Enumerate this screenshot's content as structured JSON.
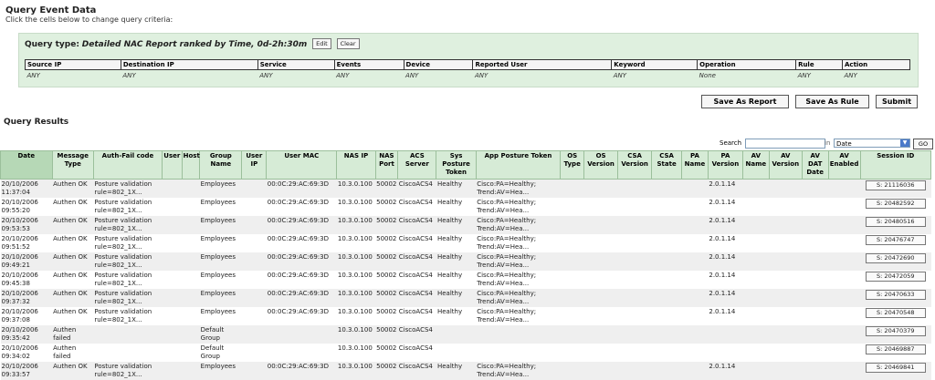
{
  "header": {
    "title": "Query Event Data",
    "subtitle": "Click the cells below to change query criteria:"
  },
  "query": {
    "label": "Query type:",
    "value": "Detailed NAC Report ranked by Time, 0d-2h:30m",
    "edit": "Edit",
    "clear": "Clear"
  },
  "criteria": {
    "headers": [
      "Source IP",
      "Destination IP",
      "Service",
      "Events",
      "Device",
      "Reported User",
      "Keyword",
      "Operation",
      "Rule",
      "Action"
    ],
    "values": [
      "ANY",
      "ANY",
      "ANY",
      "ANY",
      "ANY",
      "ANY",
      "ANY",
      "None",
      "ANY",
      "ANY"
    ]
  },
  "actions": {
    "save_report": "Save As Report",
    "save_rule": "Save As Rule",
    "submit": "Submit"
  },
  "results_title": "Query Results",
  "search": {
    "label": "Search",
    "in_label": "in",
    "field": "Date",
    "go": "GO"
  },
  "columns": [
    "Date",
    "Message Type",
    "Auth-Fail code",
    "User",
    "Host",
    "Group Name",
    "User IP",
    "User MAC",
    "NAS IP",
    "NAS Port",
    "ACS Server",
    "Sys Posture Token",
    "App Posture Token",
    "OS Type",
    "OS Version",
    "CSA Version",
    "CSA State",
    "PA Name",
    "PA Version",
    "AV Name",
    "AV Version",
    "AV DAT Date",
    "AV Enabled",
    "Session ID"
  ],
  "rows": [
    [
      "20/10/2006 11:37:04",
      "Authen OK",
      "Posture validation rule=802_1X...",
      "",
      "",
      "Employees",
      "",
      "00:0C:29:AC:69:3D",
      "10.3.0.100",
      "50002",
      "CiscoACS4",
      "Healthy",
      "Cisco:PA=Healthy; Trend:AV=Hea...",
      "",
      "",
      "",
      "",
      "",
      "2.0.1.14",
      "",
      "",
      "",
      "",
      "S: 21116036"
    ],
    [
      "20/10/2006 09:55:20",
      "Authen OK",
      "Posture validation rule=802_1X...",
      "",
      "",
      "Employees",
      "",
      "00:0C:29:AC:69:3D",
      "10.3.0.100",
      "50002",
      "CiscoACS4",
      "Healthy",
      "Cisco:PA=Healthy; Trend:AV=Hea...",
      "",
      "",
      "",
      "",
      "",
      "2.0.1.14",
      "",
      "",
      "",
      "",
      "S: 20482592"
    ],
    [
      "20/10/2006 09:53:53",
      "Authen OK",
      "Posture validation rule=802_1X...",
      "",
      "",
      "Employees",
      "",
      "00:0C:29:AC:69:3D",
      "10.3.0.100",
      "50002",
      "CiscoACS4",
      "Healthy",
      "Cisco:PA=Healthy; Trend:AV=Hea...",
      "",
      "",
      "",
      "",
      "",
      "2.0.1.14",
      "",
      "",
      "",
      "",
      "S: 20480516"
    ],
    [
      "20/10/2006 09:51:52",
      "Authen OK",
      "Posture validation rule=802_1X...",
      "",
      "",
      "Employees",
      "",
      "00:0C:29:AC:69:3D",
      "10.3.0.100",
      "50002",
      "CiscoACS4",
      "Healthy",
      "Cisco:PA=Healthy; Trend:AV=Hea...",
      "",
      "",
      "",
      "",
      "",
      "2.0.1.14",
      "",
      "",
      "",
      "",
      "S: 20476747"
    ],
    [
      "20/10/2006 09:49:21",
      "Authen OK",
      "Posture validation rule=802_1X...",
      "",
      "",
      "Employees",
      "",
      "00:0C:29:AC:69:3D",
      "10.3.0.100",
      "50002",
      "CiscoACS4",
      "Healthy",
      "Cisco:PA=Healthy; Trend:AV=Hea...",
      "",
      "",
      "",
      "",
      "",
      "2.0.1.14",
      "",
      "",
      "",
      "",
      "S: 20472690"
    ],
    [
      "20/10/2006 09:45:38",
      "Authen OK",
      "Posture validation rule=802_1X...",
      "",
      "",
      "Employees",
      "",
      "00:0C:29:AC:69:3D",
      "10.3.0.100",
      "50002",
      "CiscoACS4",
      "Healthy",
      "Cisco:PA=Healthy; Trend:AV=Hea...",
      "",
      "",
      "",
      "",
      "",
      "2.0.1.14",
      "",
      "",
      "",
      "",
      "S: 20472059"
    ],
    [
      "20/10/2006 09:37:32",
      "Authen OK",
      "Posture validation rule=802_1X...",
      "",
      "",
      "Employees",
      "",
      "00:0C:29:AC:69:3D",
      "10.3.0.100",
      "50002",
      "CiscoACS4",
      "Healthy",
      "Cisco:PA=Healthy; Trend:AV=Hea...",
      "",
      "",
      "",
      "",
      "",
      "2.0.1.14",
      "",
      "",
      "",
      "",
      "S: 20470633"
    ],
    [
      "20/10/2006 09:37:08",
      "Authen OK",
      "Posture validation rule=802_1X...",
      "",
      "",
      "Employees",
      "",
      "00:0C:29:AC:69:3D",
      "10.3.0.100",
      "50002",
      "CiscoACS4",
      "Healthy",
      "Cisco:PA=Healthy; Trend:AV=Hea...",
      "",
      "",
      "",
      "",
      "",
      "2.0.1.14",
      "",
      "",
      "",
      "",
      "S: 20470548"
    ],
    [
      "20/10/2006 09:35:42",
      "Authen failed",
      "",
      "",
      "",
      "Default Group",
      "",
      "",
      "10.3.0.100",
      "50002",
      "CiscoACS4",
      "",
      "",
      "",
      "",
      "",
      "",
      "",
      "",
      "",
      "",
      "",
      "",
      "S: 20470379"
    ],
    [
      "20/10/2006 09:34:02",
      "Authen failed",
      "",
      "",
      "",
      "Default Group",
      "",
      "",
      "10.3.0.100",
      "50002",
      "CiscoACS4",
      "",
      "",
      "",
      "",
      "",
      "",
      "",
      "",
      "",
      "",
      "",
      "",
      "S: 20469887"
    ],
    [
      "20/10/2006 09:33:57",
      "Authen OK",
      "Posture validation rule=802_1X...",
      "",
      "",
      "Employees",
      "",
      "00:0C:29:AC:69:3D",
      "10.3.0.100",
      "50002",
      "CiscoACS4",
      "Healthy",
      "Cisco:PA=Healthy; Trend:AV=Hea...",
      "",
      "",
      "",
      "",
      "",
      "2.0.1.14",
      "",
      "",
      "",
      "",
      "S: 20469841"
    ]
  ]
}
